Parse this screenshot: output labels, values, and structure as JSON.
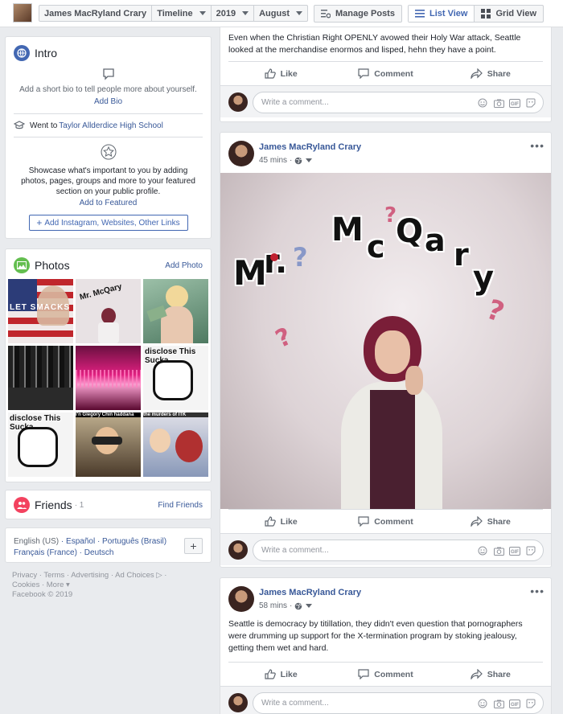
{
  "topbar": {
    "profile_name": "James MacRyland Crary",
    "timeline": "Timeline",
    "year": "2019",
    "month": "August",
    "manage_posts": "Manage Posts",
    "list_view": "List View",
    "grid_view": "Grid View"
  },
  "intro": {
    "title": "Intro",
    "bio_prompt": "Add a short bio to tell people more about yourself.",
    "add_bio": "Add Bio",
    "went_prefix": "Went to ",
    "school": "Taylor Allderdice High School",
    "featured_text": "Showcase what's important to you by adding photos, pages, groups and more to your featured section on your public profile.",
    "add_featured": "Add to Featured",
    "add_links": "Add Instagram, Websites, Other Links"
  },
  "photos": {
    "title": "Photos",
    "add_photo": "Add Photo",
    "items": [
      {
        "caption": "LET SMACKS"
      },
      {
        "caption": "Mr. McQary"
      },
      {
        "caption": ""
      },
      {
        "caption": ""
      },
      {
        "caption": ""
      },
      {
        "caption": "disclose This Sucka"
      },
      {
        "caption": "disclose This Sucka"
      },
      {
        "caption": "I'n Glegory Chin haddana"
      },
      {
        "caption": "the murders of ITK"
      }
    ]
  },
  "friends": {
    "title": "Friends",
    "count": "· 1",
    "find": "Find Friends"
  },
  "languages": {
    "line1_current": "English (US)",
    "line1_rest": " · Español · Português (Brasil)",
    "line2": "Français (France) · Deutsch"
  },
  "footer": {
    "line1": "Privacy · Terms · Advertising · Ad Choices ▷ ·",
    "line2": "Cookies · More ▾",
    "line3": "Facebook © 2019"
  },
  "posts": [
    {
      "text": "Even when the Christian Right OPENLY avowed their Holy War attack, Seattle looked at the merchandise enormos and lisped, hehn they have a point."
    },
    {
      "author": "James MacRyland Crary",
      "time": "45 mins",
      "image_title": "Mr. McQary"
    },
    {
      "author": "James MacRyland Crary",
      "time": "58 mins",
      "text": "Seattle is democracy by titillation, they didn't even question that pornographers were drumming up support for the X-termination program by stoking jealousy, getting them wet and hard."
    }
  ],
  "actions": {
    "like": "Like",
    "comment": "Comment",
    "share": "Share",
    "write_comment": "Write a comment..."
  }
}
